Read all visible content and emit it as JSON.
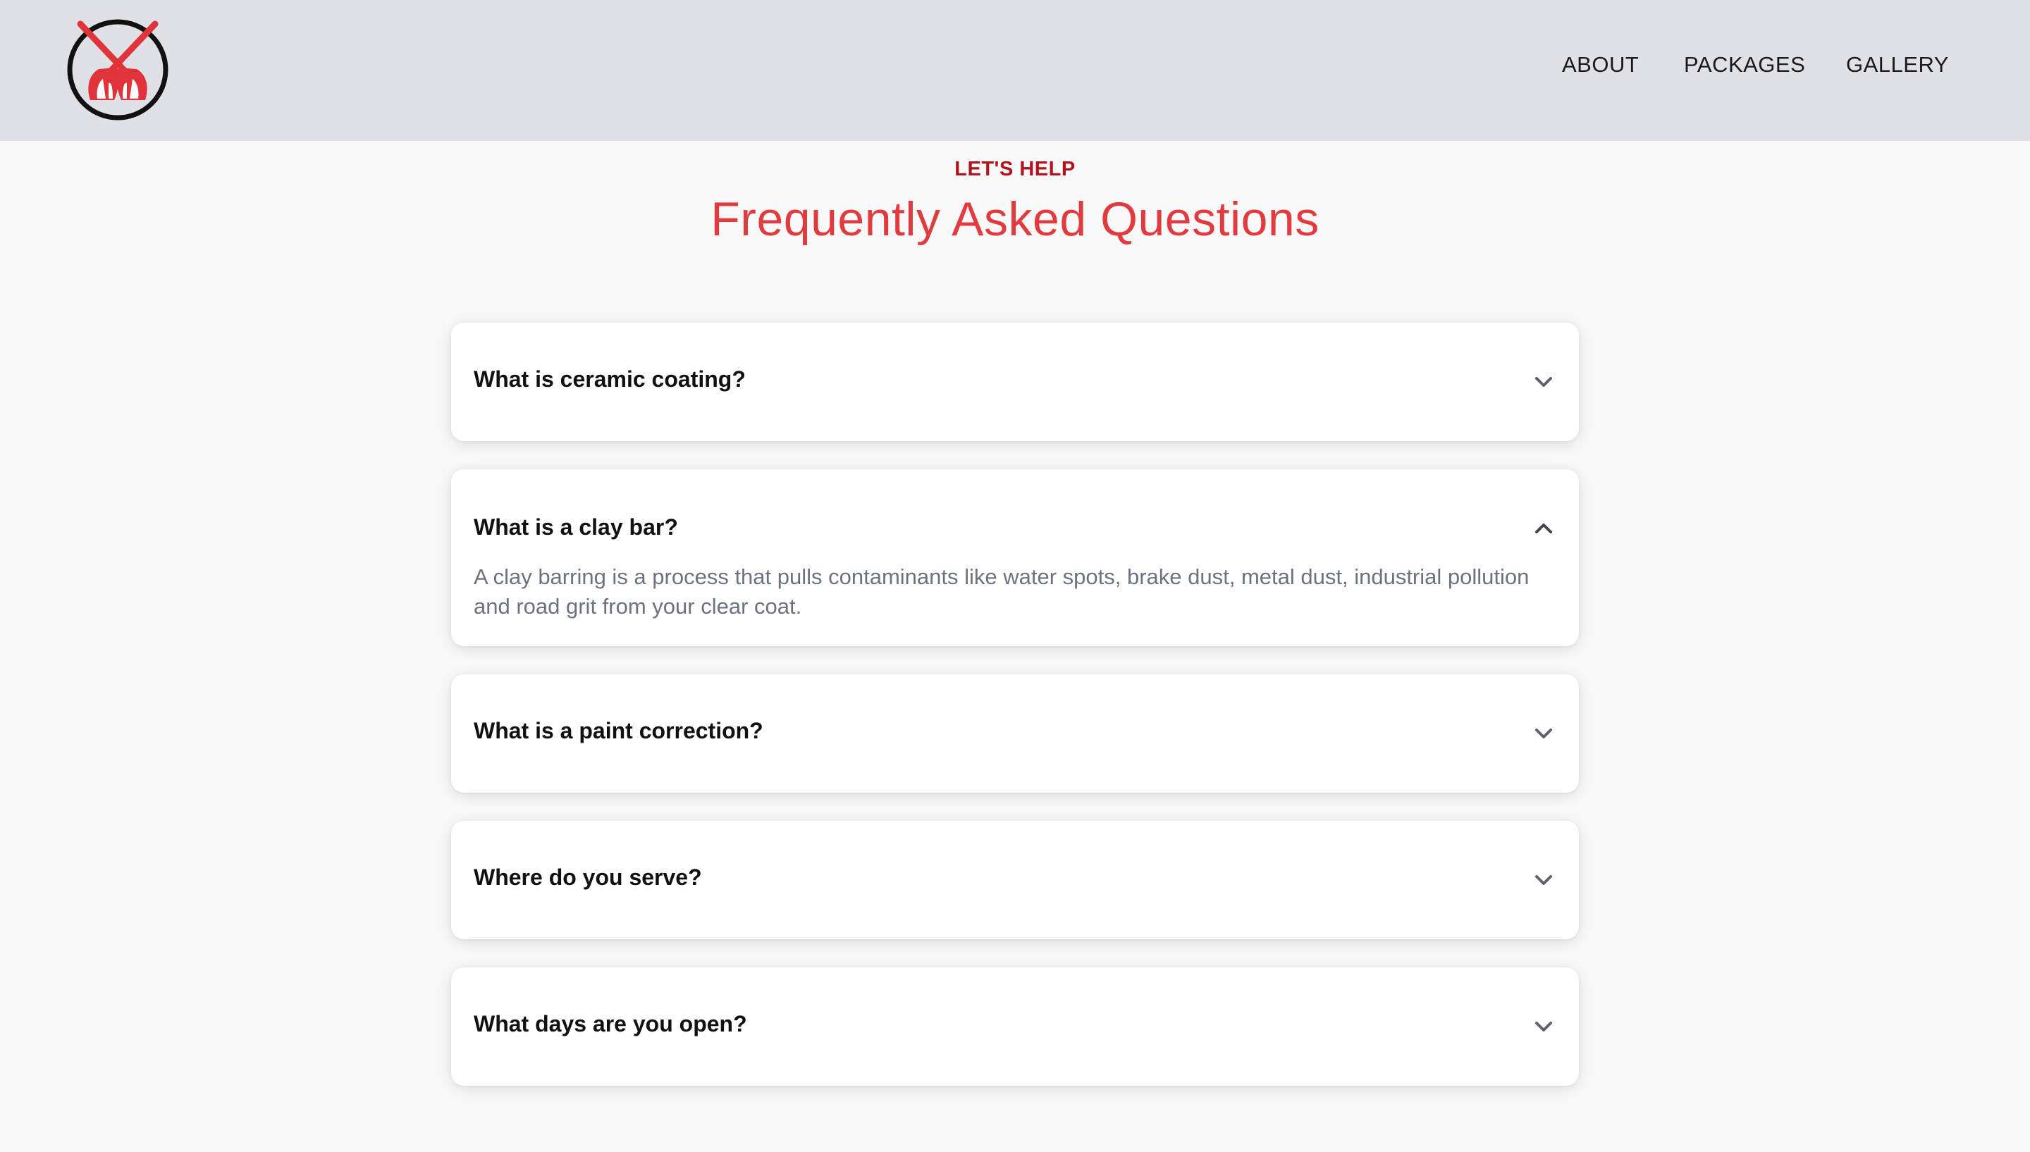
{
  "header": {
    "nav": [
      {
        "label": "ABOUT"
      },
      {
        "label": "PACKAGES"
      },
      {
        "label": "GALLERY"
      }
    ]
  },
  "hero": {
    "eyebrow": "LET'S HELP",
    "title": "Frequently Asked Questions"
  },
  "faq": {
    "items": [
      {
        "question": "What is ceramic coating?",
        "expanded": false,
        "answer": ""
      },
      {
        "question": "What is a clay bar?",
        "expanded": true,
        "answer": "A clay barring is a process that pulls contaminants like water spots, brake dust, metal dust, industrial pollution and road grit from your clear coat."
      },
      {
        "question": "What is a paint correction?",
        "expanded": false,
        "answer": ""
      },
      {
        "question": "Where do you serve?",
        "expanded": false,
        "answer": ""
      },
      {
        "question": "What days are you open?",
        "expanded": false,
        "answer": ""
      }
    ]
  },
  "colors": {
    "header_bg": "#dfe1e6",
    "page_bg": "#f9f9f9",
    "accent": "#e23b3f",
    "eyebrow": "#b1141f",
    "logo_red": "#e0343a",
    "chevron": "#5b6270"
  },
  "icons": {
    "logo": "pressure-washer-guns-logo",
    "collapsed": "chevron-down-icon",
    "expanded": "chevron-up-icon"
  }
}
